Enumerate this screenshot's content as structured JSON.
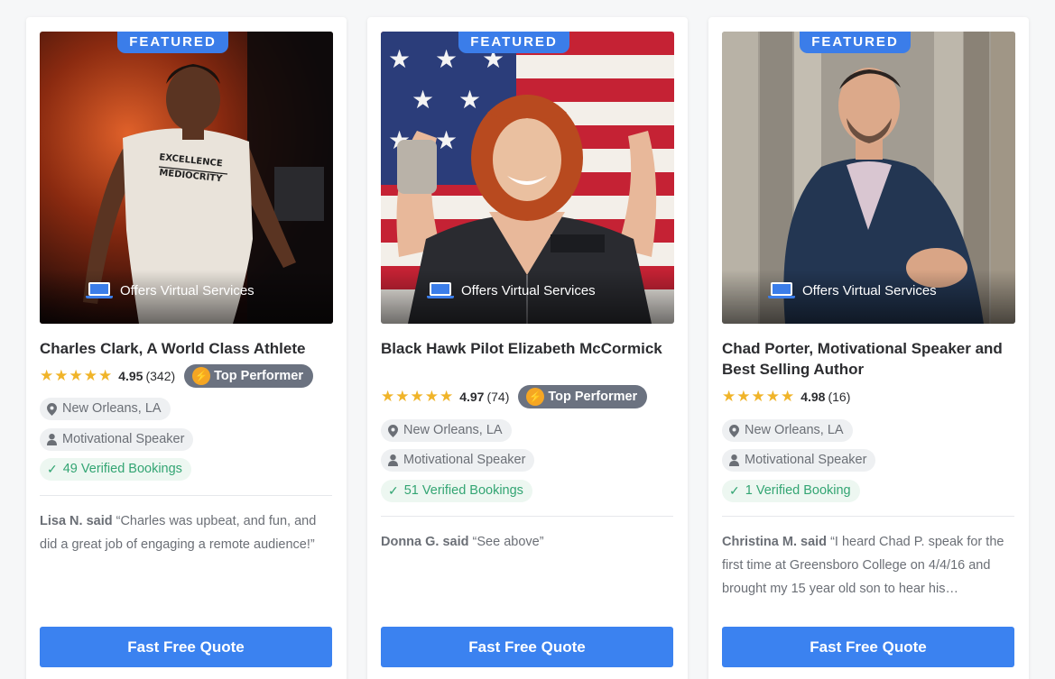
{
  "cards": [
    {
      "badge": "FEATURED",
      "virtual": "Offers Virtual Services",
      "name": "Charles Clark, A World Class Athlete",
      "stars": "★★★★★",
      "score": "4.95",
      "count": "(342)",
      "top_performer": "Top Performer",
      "location": "New Orleans, LA",
      "category": "Motivational Speaker",
      "bookings": "49 Verified Bookings",
      "reviewer": "Lisa N. said",
      "review": "“Charles was upbeat, and fun, and did a great job of engaging a remote audience!”",
      "button": "Fast Free Quote",
      "shirt_line1": "EXCELLENCE",
      "shirt_line2": "MEDIOCRITY"
    },
    {
      "badge": "FEATURED",
      "virtual": "Offers Virtual Services",
      "name": "Black Hawk Pilot Elizabeth McCormick",
      "stars": "★★★★★",
      "score": "4.97",
      "count": "(74)",
      "top_performer": "Top Performer",
      "location": "New Orleans, LA",
      "category": "Motivational Speaker",
      "bookings": "51 Verified Bookings",
      "reviewer": "Donna G. said",
      "review": "“See above”",
      "button": "Fast Free Quote"
    },
    {
      "badge": "FEATURED",
      "virtual": "Offers Virtual Services",
      "name": "Chad Porter, Motivational Speaker and Best Selling Author",
      "stars": "★★★★★",
      "score": "4.98",
      "count": "(16)",
      "location": "New Orleans, LA",
      "category": "Motivational Speaker",
      "bookings": "1 Verified Booking",
      "reviewer": "Christina M. said",
      "review": "“I heard Chad P. speak for the first time at Greensboro College on 4/4/16 and brought my 15 year old son to hear his…",
      "button": "Fast Free Quote"
    }
  ],
  "colors": {
    "accent": "#3b82f0",
    "badge": "#3b7de9",
    "star": "#f0b429",
    "verified": "#33a573",
    "top_performer_bg": "#6b7280"
  },
  "icons": [
    "laptop-icon",
    "lightning-bolt-icon",
    "location-pin-icon",
    "person-icon",
    "checkmark-icon"
  ]
}
